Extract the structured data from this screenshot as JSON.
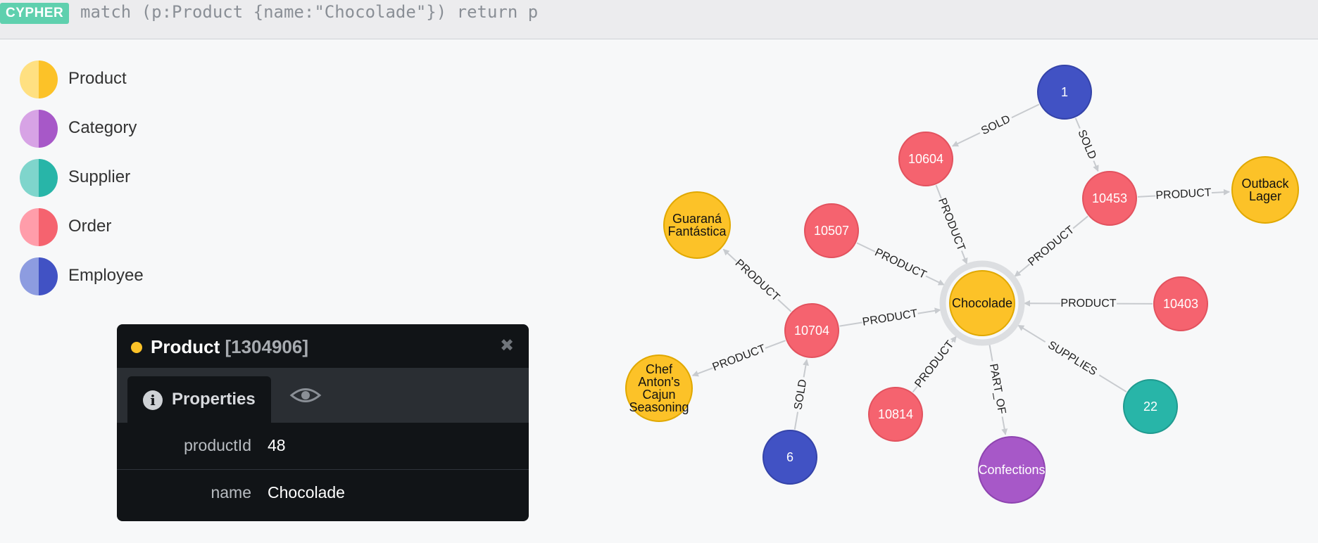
{
  "header": {
    "badge": "CYPHER",
    "query": "match (p:Product {name:\"Chocolade\"}) return p"
  },
  "legend": [
    {
      "label": "Product",
      "light": "#ffe081",
      "color": "#fcc228"
    },
    {
      "label": "Category",
      "light": "#d7a3e5",
      "color": "#a758c8"
    },
    {
      "label": "Supplier",
      "light": "#7fd5cc",
      "color": "#28b5a8"
    },
    {
      "label": "Order",
      "light": "#ff9daa",
      "color": "#f5636f"
    },
    {
      "label": "Employee",
      "light": "#8d9ce0",
      "color": "#4152c4"
    }
  ],
  "graph": {
    "nodes": [
      {
        "id": "choc",
        "label": [
          "Chocolade"
        ],
        "type": "Product",
        "selected": true
      },
      {
        "id": "e1",
        "label": [
          "1"
        ],
        "type": "Employee"
      },
      {
        "id": "o10604",
        "label": [
          "10604"
        ],
        "type": "Order"
      },
      {
        "id": "o10453",
        "label": [
          "10453"
        ],
        "type": "Order"
      },
      {
        "id": "outback",
        "label": [
          "Outback",
          "Lager"
        ],
        "type": "Product"
      },
      {
        "id": "guarana",
        "label": [
          "Guaraná",
          "Fantástica"
        ],
        "type": "Product"
      },
      {
        "id": "o10507",
        "label": [
          "10507"
        ],
        "type": "Order"
      },
      {
        "id": "o10704",
        "label": [
          "10704"
        ],
        "type": "Order"
      },
      {
        "id": "o10403",
        "label": [
          "10403"
        ],
        "type": "Order"
      },
      {
        "id": "chef",
        "label": [
          "Chef",
          "Anton's",
          "Cajun",
          "Seasoning"
        ],
        "type": "Product"
      },
      {
        "id": "e6",
        "label": [
          "6"
        ],
        "type": "Employee"
      },
      {
        "id": "o10814",
        "label": [
          "10814"
        ],
        "type": "Order"
      },
      {
        "id": "confections",
        "label": [
          "Confections"
        ],
        "type": "Category"
      },
      {
        "id": "s22",
        "label": [
          "22"
        ],
        "type": "Supplier"
      }
    ],
    "edges": [
      {
        "from": "e1",
        "to": "o10604",
        "label": "SOLD"
      },
      {
        "from": "e1",
        "to": "o10453",
        "label": "SOLD"
      },
      {
        "from": "o10453",
        "to": "outback",
        "label": "PRODUCT"
      },
      {
        "from": "o10604",
        "to": "choc",
        "label": "PRODUCT"
      },
      {
        "from": "o10453",
        "to": "choc",
        "label": "PRODUCT"
      },
      {
        "from": "o10507",
        "to": "choc",
        "label": "PRODUCT"
      },
      {
        "from": "o10704",
        "to": "choc",
        "label": "PRODUCT"
      },
      {
        "from": "o10403",
        "to": "choc",
        "label": "PRODUCT"
      },
      {
        "from": "o10814",
        "to": "choc",
        "label": "PRODUCT"
      },
      {
        "from": "choc",
        "to": "confections",
        "label": "PART_OF"
      },
      {
        "from": "s22",
        "to": "choc",
        "label": "SUPPLIES"
      },
      {
        "from": "o10704",
        "to": "guarana",
        "label": "PRODUCT"
      },
      {
        "from": "o10704",
        "to": "chef",
        "label": "PRODUCT"
      },
      {
        "from": "e6",
        "to": "o10704",
        "label": "SOLD"
      }
    ]
  },
  "panel": {
    "title": "Product",
    "id_text": "[1304906]",
    "close_icon": "close-icon",
    "tab_label": "Properties",
    "properties": [
      {
        "key": "productId",
        "value": "48"
      },
      {
        "key": "name",
        "value": "Chocolade"
      }
    ]
  }
}
